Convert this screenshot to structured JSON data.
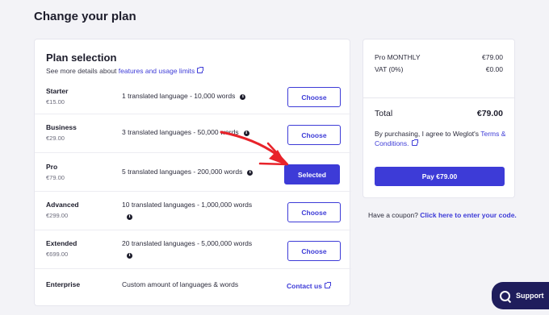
{
  "page": {
    "title": "Change your plan"
  },
  "plans": {
    "title": "Plan selection",
    "subtitle_prefix": "See more details about ",
    "subtitle_link": "features and usage limits",
    "rows": [
      {
        "name": "Starter",
        "price": "€15.00",
        "description": "1 translated language - 10,000 words",
        "action": "Choose"
      },
      {
        "name": "Business",
        "price": "€29.00",
        "description": "3 translated languages - 50,000 words",
        "action": "Choose"
      },
      {
        "name": "Pro",
        "price": "€79.00",
        "description": "5 translated languages - 200,000 words",
        "action": "Selected"
      },
      {
        "name": "Advanced",
        "price": "€299.00",
        "description": "10 translated languages - 1,000,000 words",
        "action": "Choose"
      },
      {
        "name": "Extended",
        "price": "€699.00",
        "description": "20 translated languages - 5,000,000 words",
        "action": "Choose"
      },
      {
        "name": "Enterprise",
        "price": "",
        "description": "Custom amount of languages & words",
        "action": "Contact us"
      }
    ]
  },
  "summary": {
    "plan_label": "Pro MONTHLY",
    "plan_value": "€79.00",
    "vat_label": "VAT (0%)",
    "vat_value": "€0.00",
    "total_label": "Total",
    "total_value": "€79.00",
    "agree_prefix": "By purchasing, I agree to Weglot's ",
    "agree_link": "Terms & Conditions.",
    "pay_label": "Pay €79.00"
  },
  "coupon": {
    "prefix": "Have a coupon? ",
    "link": "Click here to enter your code."
  },
  "support": {
    "label": "Support"
  },
  "colors": {
    "accent": "#3d3bd7",
    "annotation_arrow": "#e8232a",
    "support_bg": "#1f1d5c"
  }
}
